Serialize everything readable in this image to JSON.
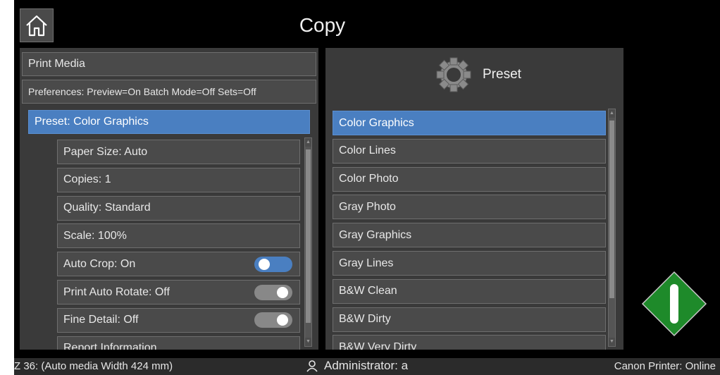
{
  "header": {
    "title": "Copy"
  },
  "left": {
    "print_media": "Print Media",
    "preferences": "Preferences: Preview=On Batch Mode=Off Sets=Off",
    "preset": "Preset: Color Graphics",
    "items": [
      {
        "label": "Paper Size: Auto"
      },
      {
        "label": "Copies: 1"
      },
      {
        "label": "Quality: Standard"
      },
      {
        "label": "Scale: 100%"
      },
      {
        "label": "Auto Crop: On",
        "toggle": "on"
      },
      {
        "label": "Print Auto Rotate: Off",
        "toggle": "off"
      },
      {
        "label": "Fine Detail: Off",
        "toggle": "off"
      },
      {
        "label": "Report Information"
      }
    ]
  },
  "right": {
    "header": "Preset",
    "presets": [
      "Color Graphics",
      "Color Lines",
      "Color Photo",
      "Gray Photo",
      "Gray Graphics",
      "Gray Lines",
      "B&W Clean",
      "B&W Dirty",
      "B&W Very Dirty"
    ],
    "selected_index": 0
  },
  "status": {
    "media": "Z 36: (Auto media Width 424 mm)",
    "user": "Administrator: a",
    "printer": "Canon Printer: Online"
  },
  "colors": {
    "accent": "#4a7fc1",
    "start": "#1e8a2a"
  }
}
